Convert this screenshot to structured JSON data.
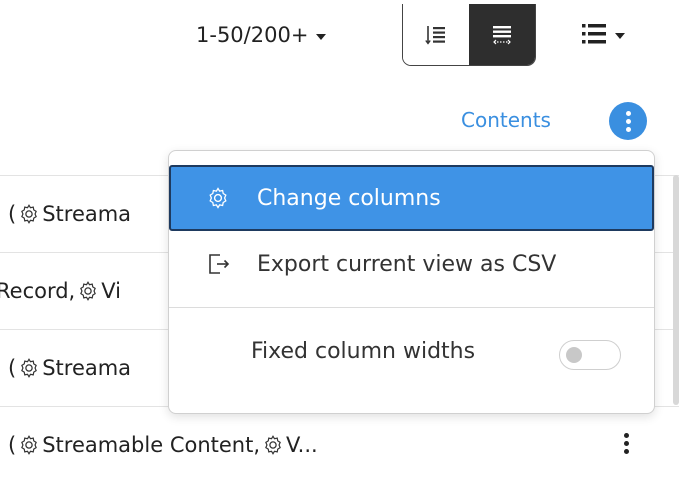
{
  "toolbar": {
    "pager_label": "1-50/200+",
    "view_modes": [
      {
        "icon": "list-sort-icon",
        "active": false
      },
      {
        "icon": "column-width-icon",
        "active": true
      }
    ],
    "menu_icon": "list-menu-icon"
  },
  "header_row": {
    "contents_label": "Contents",
    "more_icon": "kebab-vertical-icon"
  },
  "table": {
    "rows": [
      {
        "prefix": "(",
        "text": "Streama"
      },
      {
        "prefix": "Record, ",
        "text": "Vi"
      },
      {
        "prefix": "(",
        "text": "Streama"
      },
      {
        "prefix": "(",
        "text": "Streamable Content, ",
        "text2": "V..."
      }
    ]
  },
  "dropdown": {
    "items": [
      {
        "label": "Change columns",
        "icon": "gear-icon",
        "highlighted": true
      },
      {
        "label": "Export current view as CSV",
        "icon": "export-icon",
        "highlighted": false
      }
    ],
    "toggle": {
      "label": "Fixed column widths",
      "on": false
    }
  },
  "colors": {
    "accent": "#3a8fe0",
    "highlight": "#3f93e6",
    "dark": "#2e2e2e"
  }
}
